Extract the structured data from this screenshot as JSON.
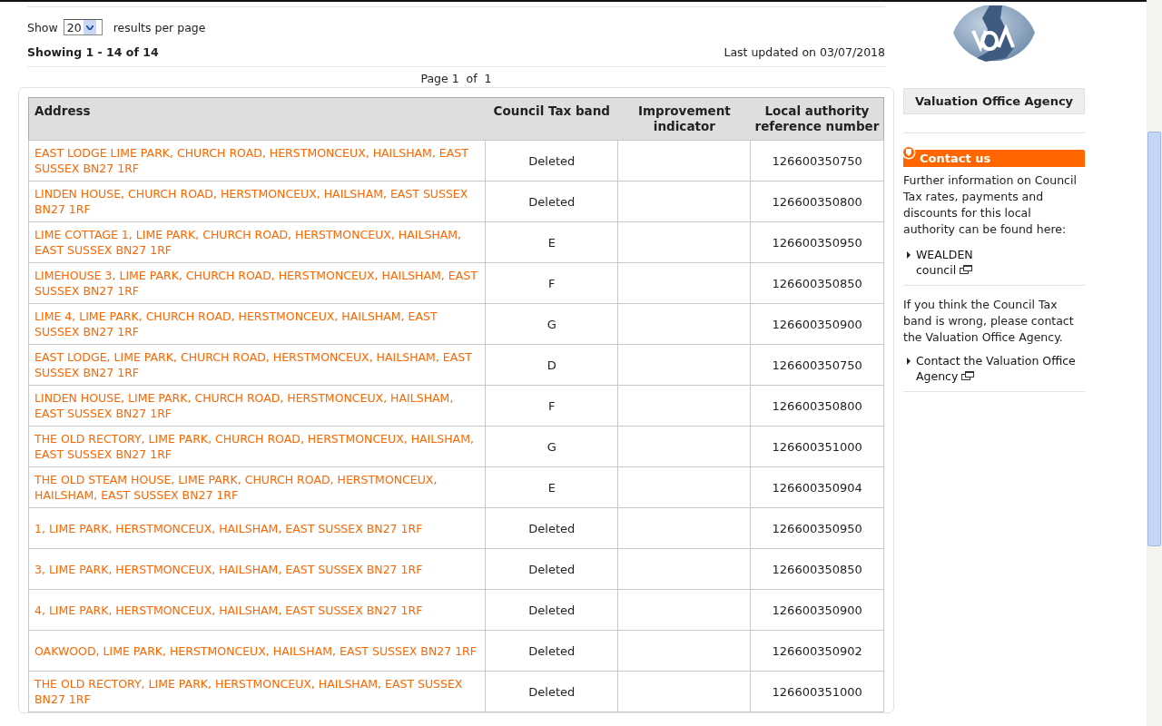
{
  "results_per_page": {
    "label_before": "Show",
    "value": "20",
    "label_after": "results per page"
  },
  "showing": "Showing 1 - 14 of 14",
  "last_updated": "Last updated on 03/07/2018",
  "pagination": "Page 1  of  1",
  "table": {
    "columns": [
      "Address",
      "Council Tax band",
      "Improvement indicator",
      "Local authority reference number"
    ],
    "rows": [
      {
        "address": "EAST LODGE LIME PARK, CHURCH ROAD, HERSTMONCEUX, HAILSHAM, EAST SUSSEX BN27 1RF",
        "band": "Deleted",
        "reference": "126600350750"
      },
      {
        "address": "LINDEN HOUSE, CHURCH ROAD, HERSTMONCEUX, HAILSHAM, EAST SUSSEX BN27 1RF",
        "band": "Deleted",
        "reference": "126600350800"
      },
      {
        "address": "LIME COTTAGE 1, LIME PARK, CHURCH ROAD, HERSTMONCEUX, HAILSHAM, EAST SUSSEX BN27 1RF",
        "band": "E",
        "reference": "126600350950"
      },
      {
        "address": "LIMEHOUSE 3, LIME PARK, CHURCH ROAD, HERSTMONCEUX, HAILSHAM, EAST SUSSEX BN27 1RF",
        "band": "F",
        "reference": "126600350850"
      },
      {
        "address": "LIME 4, LIME PARK, CHURCH ROAD, HERSTMONCEUX, HAILSHAM, EAST SUSSEX BN27 1RF",
        "band": "G",
        "reference": "126600350900"
      },
      {
        "address": "EAST LODGE, LIME PARK, CHURCH ROAD, HERSTMONCEUX, HAILSHAM, EAST SUSSEX BN27 1RF",
        "band": "D",
        "reference": "126600350750"
      },
      {
        "address": "LINDEN HOUSE, LIME PARK, CHURCH ROAD, HERSTMONCEUX, HAILSHAM, EAST SUSSEX BN27 1RF",
        "band": "F",
        "reference": "126600350800"
      },
      {
        "address": "THE OLD RECTORY, LIME PARK, CHURCH ROAD, HERSTMONCEUX, HAILSHAM, EAST SUSSEX BN27 1RF",
        "band": "G",
        "reference": "126600351000"
      },
      {
        "address": "THE OLD STEAM HOUSE, LIME PARK, CHURCH ROAD, HERSTMONCEUX, HAILSHAM, EAST SUSSEX BN27 1RF",
        "band": "E",
        "reference": "126600350904"
      },
      {
        "address": "1, LIME PARK, HERSTMONCEUX, HAILSHAM, EAST SUSSEX BN27 1RF",
        "band": "Deleted",
        "reference": "126600350950"
      },
      {
        "address": "3, LIME PARK, HERSTMONCEUX, HAILSHAM, EAST SUSSEX BN27 1RF",
        "band": "Deleted",
        "reference": "126600350850"
      },
      {
        "address": "4, LIME PARK, HERSTMONCEUX, HAILSHAM, EAST SUSSEX BN27 1RF",
        "band": "Deleted",
        "reference": "126600350900"
      },
      {
        "address": "OAKWOOD, LIME PARK, HERSTMONCEUX, HAILSHAM, EAST SUSSEX BN27 1RF",
        "band": "Deleted",
        "reference": "126600350902"
      },
      {
        "address": "THE OLD RECTORY, LIME PARK, HERSTMONCEUX, HAILSHAM, EAST SUSSEX BN27 1RF",
        "band": "Deleted",
        "reference": "126600351000"
      }
    ]
  },
  "sidebar": {
    "agency_name": "Valuation Office Agency",
    "contact_title": "Contact us",
    "info_text": "Further information on Council Tax rates, payments and discounts for this local authority can be found here:",
    "council_link": "WEALDEN council",
    "wrong_band_text": "If you think the Council Tax band is wrong, please contact the Valuation Office Agency.",
    "contact_link": "Contact the Valuation Office Agency"
  }
}
